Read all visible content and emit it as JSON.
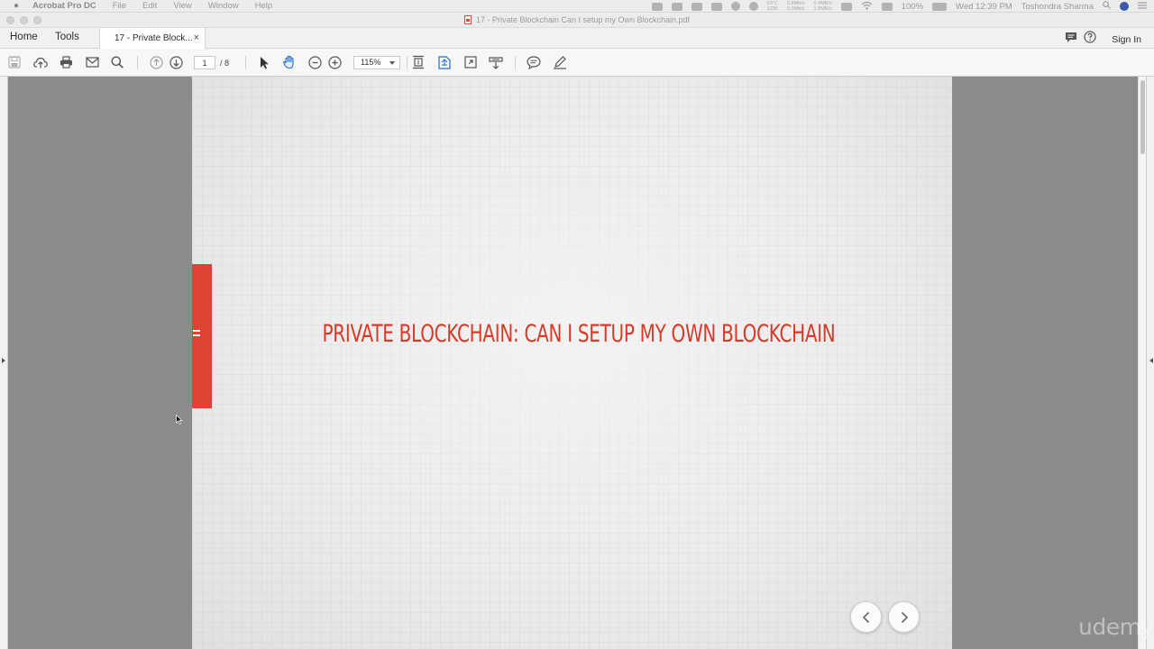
{
  "menubar": {
    "app_name": "Acrobat Pro DC",
    "menus": [
      "File",
      "Edit",
      "View",
      "Window",
      "Help"
    ],
    "tray_stats": [
      "53°C",
      "1296",
      "0.8Mb/s",
      "0.0Mb/s",
      "0.4MB/s",
      "1.5MB/s"
    ],
    "battery": "100%",
    "clock": "Wed 12:39 PM",
    "user": "Toshondra Sharma"
  },
  "window": {
    "title": "17 - Private Blockchain Can I setup my Own Blockchain.pdf"
  },
  "tabs": {
    "home": "Home",
    "tools": "Tools",
    "document": "17 - Private Block...",
    "close": "×",
    "sign_in": "Sign In"
  },
  "toolbar": {
    "page_current": "1",
    "page_total": "/ 8",
    "zoom": "115%"
  },
  "slide": {
    "title": "PRIVATE BLOCKCHAIN: CAN I SETUP MY OWN BLOCKCHAIN",
    "accent_color": "#dd4436"
  },
  "watermark": "udemy"
}
